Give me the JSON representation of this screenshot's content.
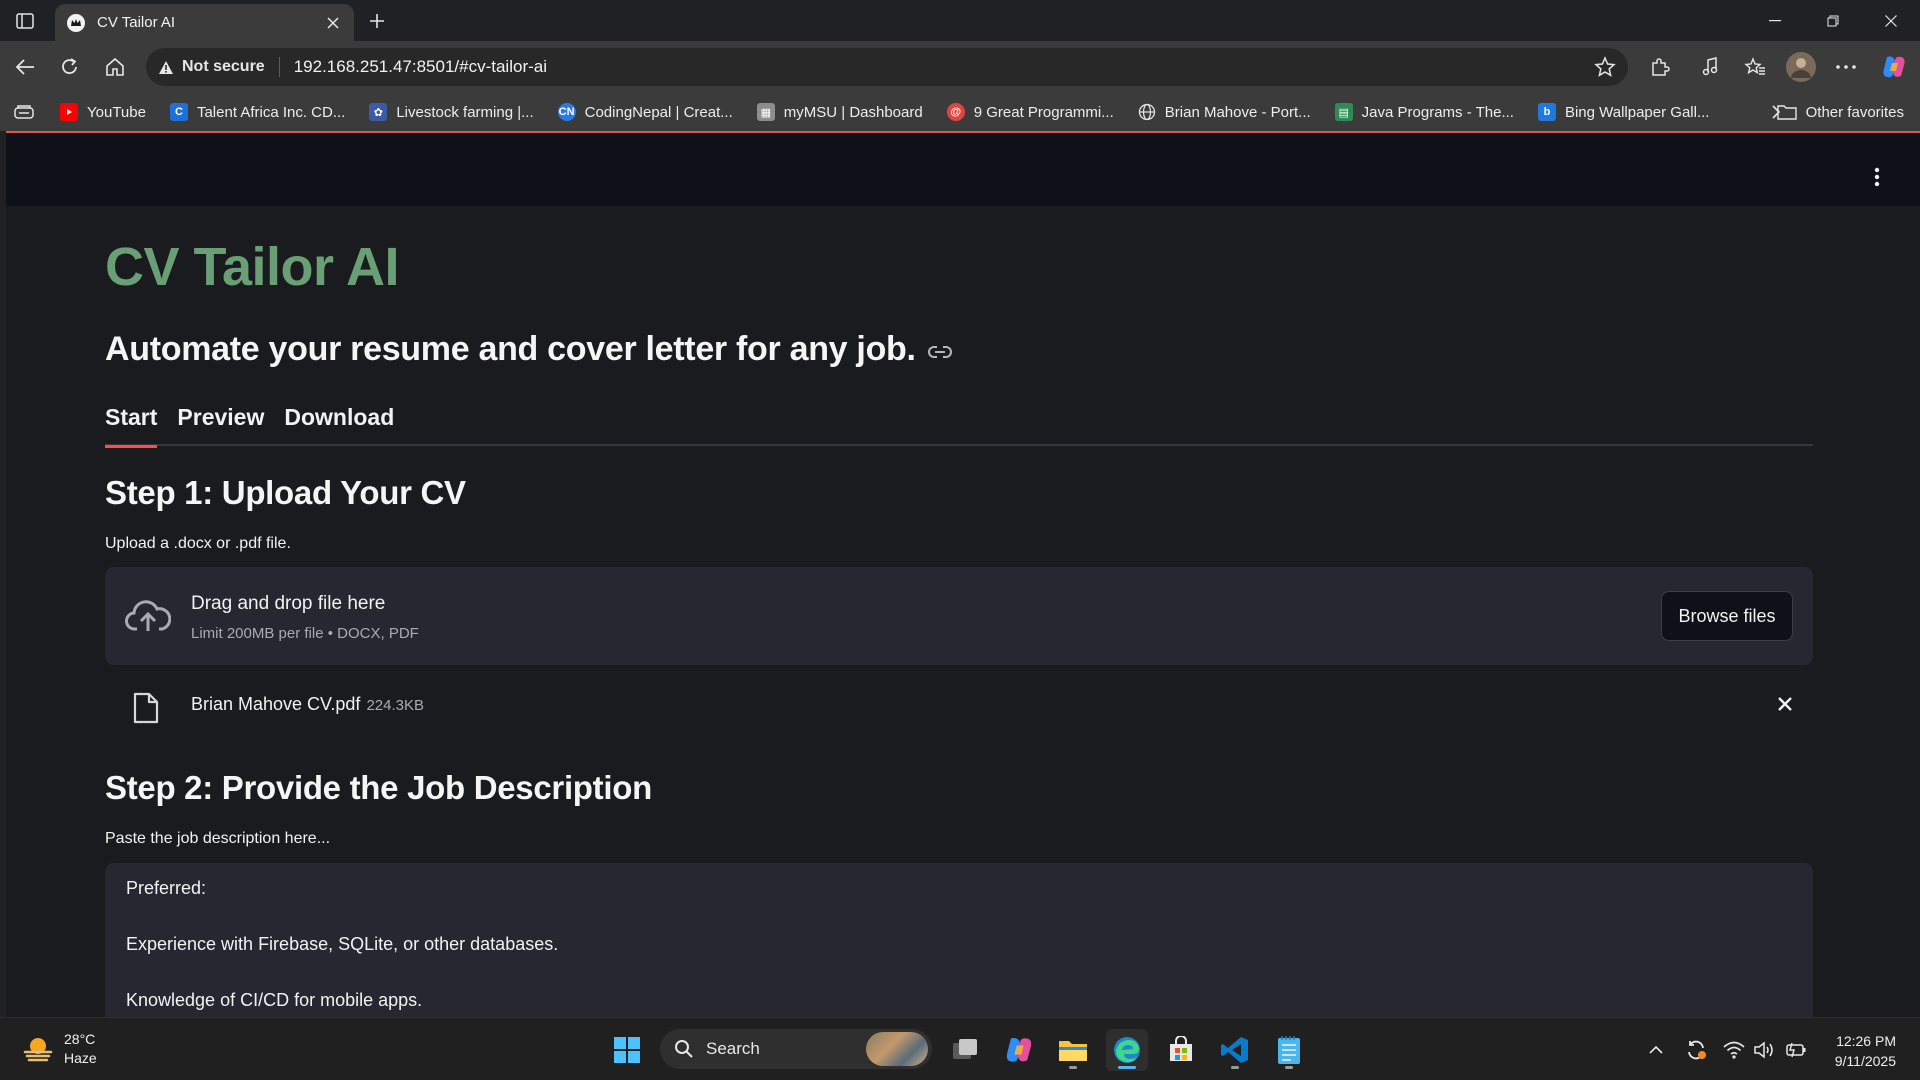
{
  "browser": {
    "tab_title": "CV Tailor AI",
    "not_secure_label": "Not secure",
    "url": "192.168.251.47:8501/#cv-tailor-ai",
    "favorites": [
      {
        "label": "YouTube",
        "icon": "youtube-icon",
        "color": "#ff0000"
      },
      {
        "label": "Talent Africa Inc. CD...",
        "icon": "talent-africa-icon",
        "color": "#1e6fd9"
      },
      {
        "label": "Livestock farming |...",
        "icon": "livestock-icon",
        "color": "#3b5ba5"
      },
      {
        "label": "CodingNepal | Creat...",
        "icon": "codingnepal-icon",
        "color": "#2a7ae2"
      },
      {
        "label": "myMSU | Dashboard",
        "icon": "mymsu-icon",
        "color": "#8d8d8d"
      },
      {
        "label": "9 Great Programmi...",
        "icon": "programming-icon",
        "color": "#e0443e"
      },
      {
        "label": "Brian Mahove - Port...",
        "icon": "globe-icon",
        "color": "#6b6b6b"
      },
      {
        "label": "Java Programs - The...",
        "icon": "java-programs-icon",
        "color": "#2e8b57"
      },
      {
        "label": "Bing Wallpaper Gall...",
        "icon": "bing-icon",
        "color": "#1f7ae0"
      }
    ],
    "other_favorites": "Other favorites"
  },
  "app": {
    "title": "CV Tailor AI",
    "subtitle": "Automate your resume and cover letter for any job.",
    "tabs": [
      {
        "label": "Start",
        "active": true
      },
      {
        "label": "Preview",
        "active": false
      },
      {
        "label": "Download",
        "active": false
      }
    ],
    "step1": {
      "heading": "Step 1: Upload Your CV",
      "label": "Upload a .docx or .pdf file.",
      "dropzone_title": "Drag and drop file here",
      "dropzone_limit": "Limit 200MB per file • DOCX, PDF",
      "browse_button": "Browse files",
      "file": {
        "name": "Brian Mahove CV.pdf",
        "size": "224.3KB"
      }
    },
    "step2": {
      "heading": "Step 2: Provide the Job Description",
      "label": "Paste the job description here...",
      "lines": [
        "Preferred:",
        "Experience with Firebase, SQLite, or other databases.",
        "Knowledge of CI/CD for mobile apps."
      ]
    },
    "accent_color": "#6a9e75",
    "active_tab_color": "#ff4b4b"
  },
  "taskbar": {
    "weather_temp": "28°C",
    "weather_desc": "Haze",
    "search_label": "Search",
    "time": "12:26 PM",
    "date": "9/11/2025"
  }
}
